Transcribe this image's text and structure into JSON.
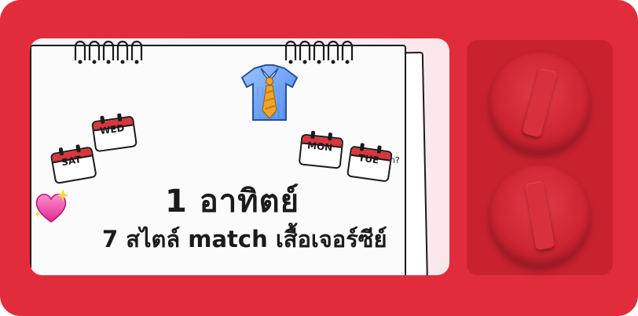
{
  "banner": {
    "headline_line1": "1 อาทิตย์",
    "headline_line2": "7 สไตล์ match เสื้อเจอร์ซีย์",
    "caption": "ใส่อะไรดีน้า?",
    "calendar_tags": [
      "WED",
      "SAT",
      "MON",
      "TUE"
    ],
    "decorations": [
      "shirt-tie-icon",
      "sparkling-heart-icon",
      "calendar-icon"
    ]
  },
  "controls": {
    "knobs": [
      "dial-knob-top",
      "dial-knob-bottom"
    ]
  },
  "colors": {
    "frame": "#e12d3b",
    "panel": "#c9222f",
    "ink": "#1b1b1b"
  }
}
